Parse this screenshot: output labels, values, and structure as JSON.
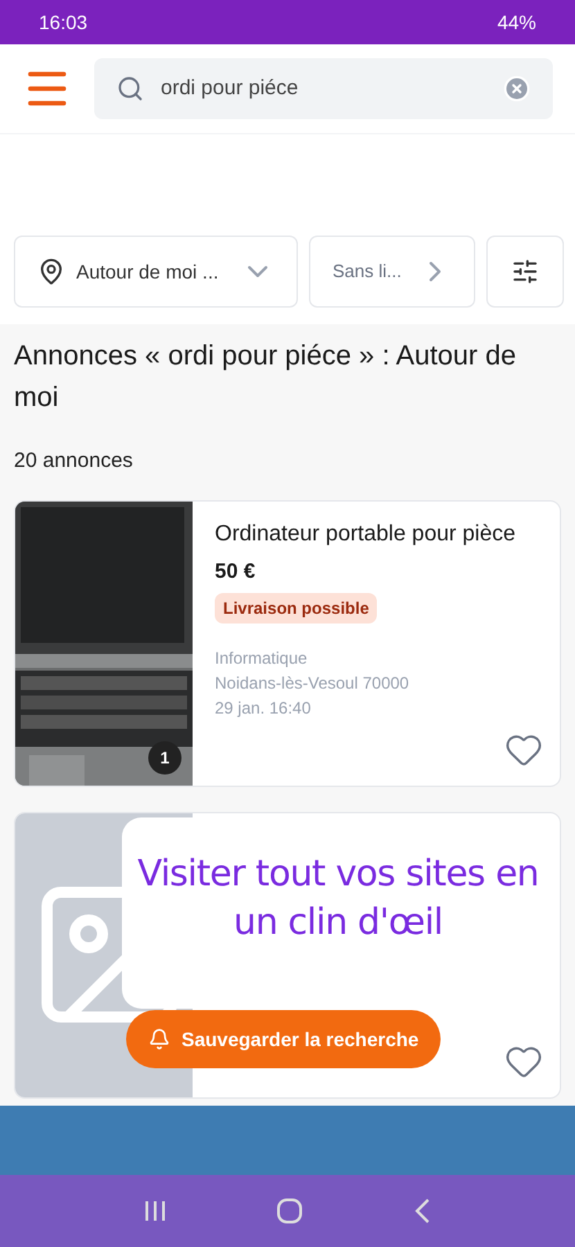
{
  "status_bar": {
    "time": "16:03",
    "battery": "44%"
  },
  "search": {
    "value": "ordi pour piéce"
  },
  "filters": [
    {
      "kind": "location",
      "label": "Autour de moi ..."
    },
    {
      "kind": "link",
      "label": "Sans li..."
    },
    {
      "kind": "settings"
    }
  ],
  "heading": "Annonces « ordi pour piéce » : Autour de moi",
  "count": "20 annonces",
  "listings": [
    {
      "kind": "picture",
      "title": "Ordinateur portable pour pièce",
      "price": "50 €",
      "badge": "Livraison possible",
      "category": "Informatique",
      "location": "Noidans-lès-Vesoul 70000",
      "date": "29 jan. 16:40",
      "photo_count": "1",
      "favorite": false
    },
    {
      "kind": "placeholder",
      "favorite": false
    }
  ],
  "save_button": "Sauvegarder la recherche",
  "bubble": "Visiter tout vos sites en un clin d'œil"
}
